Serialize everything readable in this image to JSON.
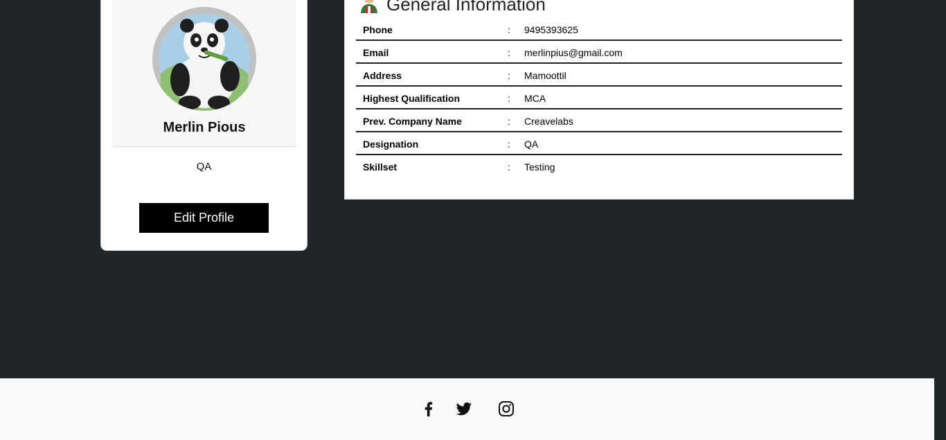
{
  "profile": {
    "name": "Merlin Pious",
    "role": "QA",
    "edit_button": "Edit Profile",
    "avatar_icon": "panda-avatar-icon"
  },
  "info": {
    "title": "General Information",
    "title_icon": "user-profile-icon",
    "rows": [
      {
        "label": "Phone",
        "separator": ":",
        "value": "9495393625"
      },
      {
        "label": "Email",
        "separator": ":",
        "value": "merlinpius@gmail.com"
      },
      {
        "label": "Address",
        "separator": ":",
        "value": "Mamoottil"
      },
      {
        "label": "Highest Qualification",
        "separator": ":",
        "value": "MCA"
      },
      {
        "label": "Prev. Company Name",
        "separator": ":",
        "value": "Creavelabs"
      },
      {
        "label": "Designation",
        "separator": ":",
        "value": "QA"
      },
      {
        "label": "Skillset",
        "separator": ":",
        "value": "Testing"
      }
    ]
  },
  "footer": {
    "social_icons": [
      "facebook-icon",
      "twitter-icon",
      "instagram-icon"
    ]
  },
  "colors": {
    "page_background": "#212529",
    "card_background": "#ffffff",
    "button_background": "#000000",
    "footer_background": "#f8f9fa"
  }
}
